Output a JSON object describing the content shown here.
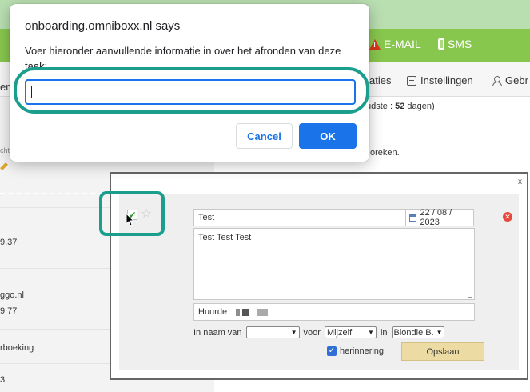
{
  "header_nav": {
    "email": "E-MAIL",
    "sms": "SMS"
  },
  "main_nav": {
    "item_partial": "aties",
    "settings": "Instellingen",
    "user_partial": "Gebr"
  },
  "left_list": {
    "item1": "en",
    "item2": "chte",
    "item3": "9.37",
    "item4": "ggo.nl",
    "item5": "9 77",
    "item6": "rboeking",
    "item7": "3"
  },
  "right_pane": {
    "oldest": "udste : ",
    "oldest_count": "52",
    "oldest_suffix": " dagen)",
    "note": "oreken."
  },
  "dialog": {
    "title": "onboarding.omniboxx.nl says",
    "message": "Voer hieronder aanvullende informatie in over het afronden van deze taak:",
    "input_value": "",
    "cancel_label": "Cancel",
    "ok_label": "OK"
  },
  "task": {
    "close_label": "x",
    "subject": "Test",
    "date": "22 / 08 / 2023",
    "description": "Test Test Test",
    "relation_prefix": "Huurde",
    "on_behalf_label": "In naam van",
    "on_behalf_value": "",
    "for_label": "voor",
    "for_value": "Mijzelf",
    "in_label": "in",
    "in_value": "Blondie B.",
    "reminder_label": "herinnering",
    "save_label": "Opslaan"
  },
  "colors": {
    "highlight": "#1c9e8d",
    "brand_green": "#88c74e",
    "dialog_blue": "#1a73e8"
  }
}
